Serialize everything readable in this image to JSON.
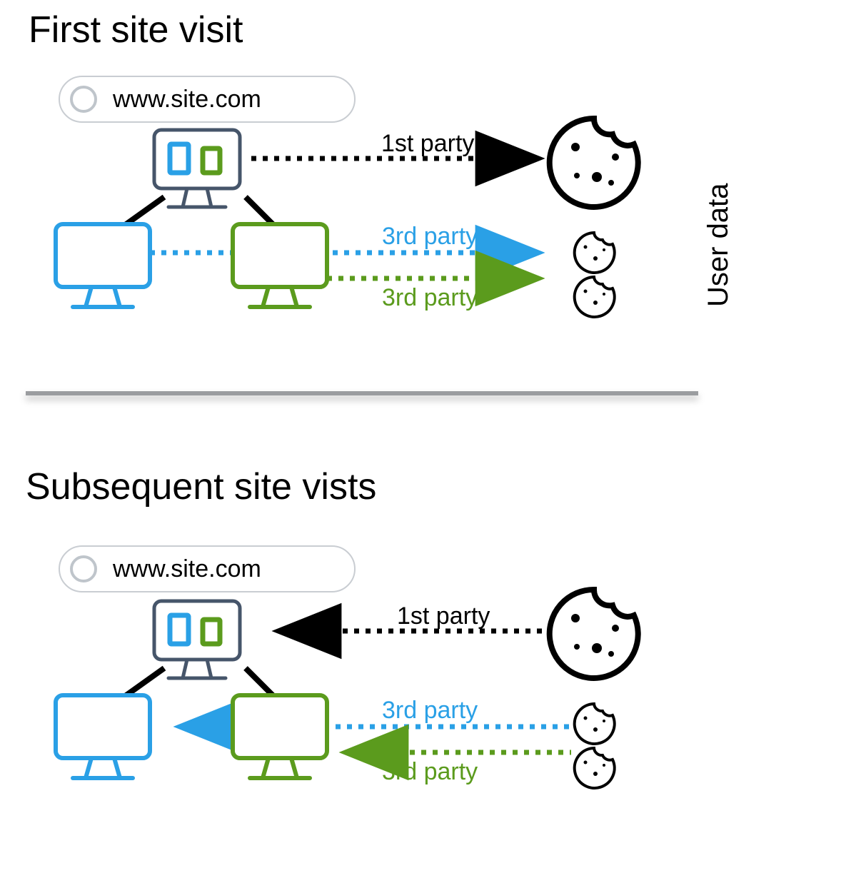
{
  "sections": {
    "first_visit": {
      "title": "First site visit",
      "url": "www.site.com",
      "arrows": {
        "first_party": "1st party",
        "third_party_blue": "3rd party",
        "third_party_green": "3rd party"
      }
    },
    "subsequent_visit": {
      "title": "Subsequent site vists",
      "url": "www.site.com",
      "arrows": {
        "first_party": "1st party",
        "third_party_blue": "3rd party",
        "third_party_green": "3rd party"
      }
    }
  },
  "side_label": "User data",
  "colors": {
    "black": "#000000",
    "blue": "#2aa0e6",
    "green": "#5b9b1d",
    "slate": "#46556a",
    "pill_border": "#c9cdd2",
    "divider": "#9b9da0"
  }
}
